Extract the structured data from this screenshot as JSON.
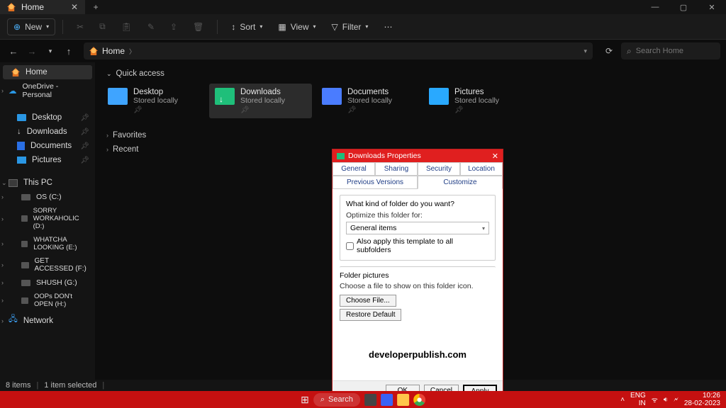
{
  "titlebar": {
    "tab": "Home"
  },
  "toolbar": {
    "new": "New",
    "sort": "Sort",
    "view": "View",
    "filter": "Filter"
  },
  "nav": {
    "breadcrumb_home": "Home",
    "search_placeholder": "Search Home"
  },
  "sidebar": {
    "home": "Home",
    "onedrive": "OneDrive - Personal",
    "desktop": "Desktop",
    "downloads": "Downloads",
    "documents": "Documents",
    "pictures": "Pictures",
    "thispc": "This PC",
    "drives": [
      "OS (C:)",
      "SORRY WORKAHOLIC (D:)",
      "WHATCHA LOOKING (E:)",
      "GET ACCESSED (F:)",
      "SHUSH (G:)",
      "OOPs DON't OPEN (H:)"
    ],
    "network": "Network"
  },
  "content": {
    "quickaccess": "Quick access",
    "folders": [
      {
        "name": "Desktop",
        "sub": "Stored locally",
        "color": "#3fa4ff"
      },
      {
        "name": "Downloads",
        "sub": "Stored locally",
        "color": "#1fbf7a"
      },
      {
        "name": "Documents",
        "sub": "Stored locally",
        "color": "#4a7cff"
      },
      {
        "name": "Pictures",
        "sub": "Stored locally",
        "color": "#29a9ff"
      }
    ],
    "favorites": "Favorites",
    "recent": "Recent"
  },
  "status": {
    "items": "8 items",
    "selected": "1 item selected"
  },
  "dialog": {
    "title": "Downloads Properties",
    "tabs": {
      "general": "General",
      "sharing": "Sharing",
      "security": "Security",
      "location": "Location",
      "prev": "Previous Versions",
      "customize": "Customize"
    },
    "q": "What kind of folder do you want?",
    "opt": "Optimize this folder for:",
    "combo": "General items",
    "apply_sub": "Also apply this template to all subfolders",
    "fp": "Folder pictures",
    "fp_sub": "Choose a file to show on this folder icon.",
    "choose": "Choose File...",
    "restore": "Restore Default",
    "watermark": "developerpublish.com",
    "ok": "OK",
    "cancel": "Cancel",
    "apply": "Apply"
  },
  "taskbar": {
    "search": "Search",
    "lang1": "ENG",
    "lang2": "IN",
    "time": "10:26",
    "date": "28-02-2023"
  }
}
